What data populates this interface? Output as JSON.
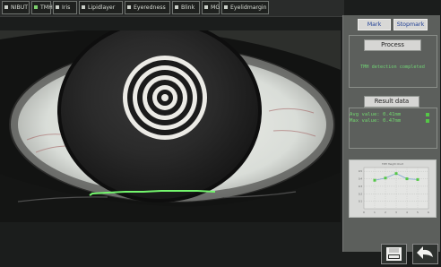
{
  "tabs": [
    {
      "label": "NIBUT"
    },
    {
      "label": "TMH"
    },
    {
      "label": "Iris"
    },
    {
      "label": "Lipidlayer"
    },
    {
      "label": "Eyeredness"
    },
    {
      "label": "Blink"
    },
    {
      "label": "MG"
    },
    {
      "label": "Eyelidmargin"
    }
  ],
  "panel": {
    "mark_label": "Mark",
    "stopmark_label": "Stopmark",
    "process_label": "Process",
    "status_text": "TMH detection completed",
    "result_label": "Result data",
    "avg_value": "Avg value: 0.41mm",
    "max_value": "Max value: 0.47mm"
  },
  "chart_data": {
    "type": "line",
    "title": "TMH Height Chart",
    "x": [
      1,
      2,
      3,
      4,
      5
    ],
    "values": [
      0.38,
      0.41,
      0.47,
      0.4,
      0.39
    ],
    "x_ticks": [
      "0",
      "1",
      "2",
      "3",
      "4",
      "5",
      "6"
    ],
    "y_ticks": [
      "0.5",
      "0.4",
      "0.3",
      "0.2",
      "0.1"
    ],
    "xlim": [
      0,
      6
    ],
    "ylim": [
      0,
      0.55
    ],
    "grid": true
  },
  "colors": {
    "accent_green": "#54c746",
    "status_green": "#71d275",
    "blue_button_text": "#1f3f96"
  },
  "icons": [
    "save-icon",
    "back-arrow-icon"
  ]
}
